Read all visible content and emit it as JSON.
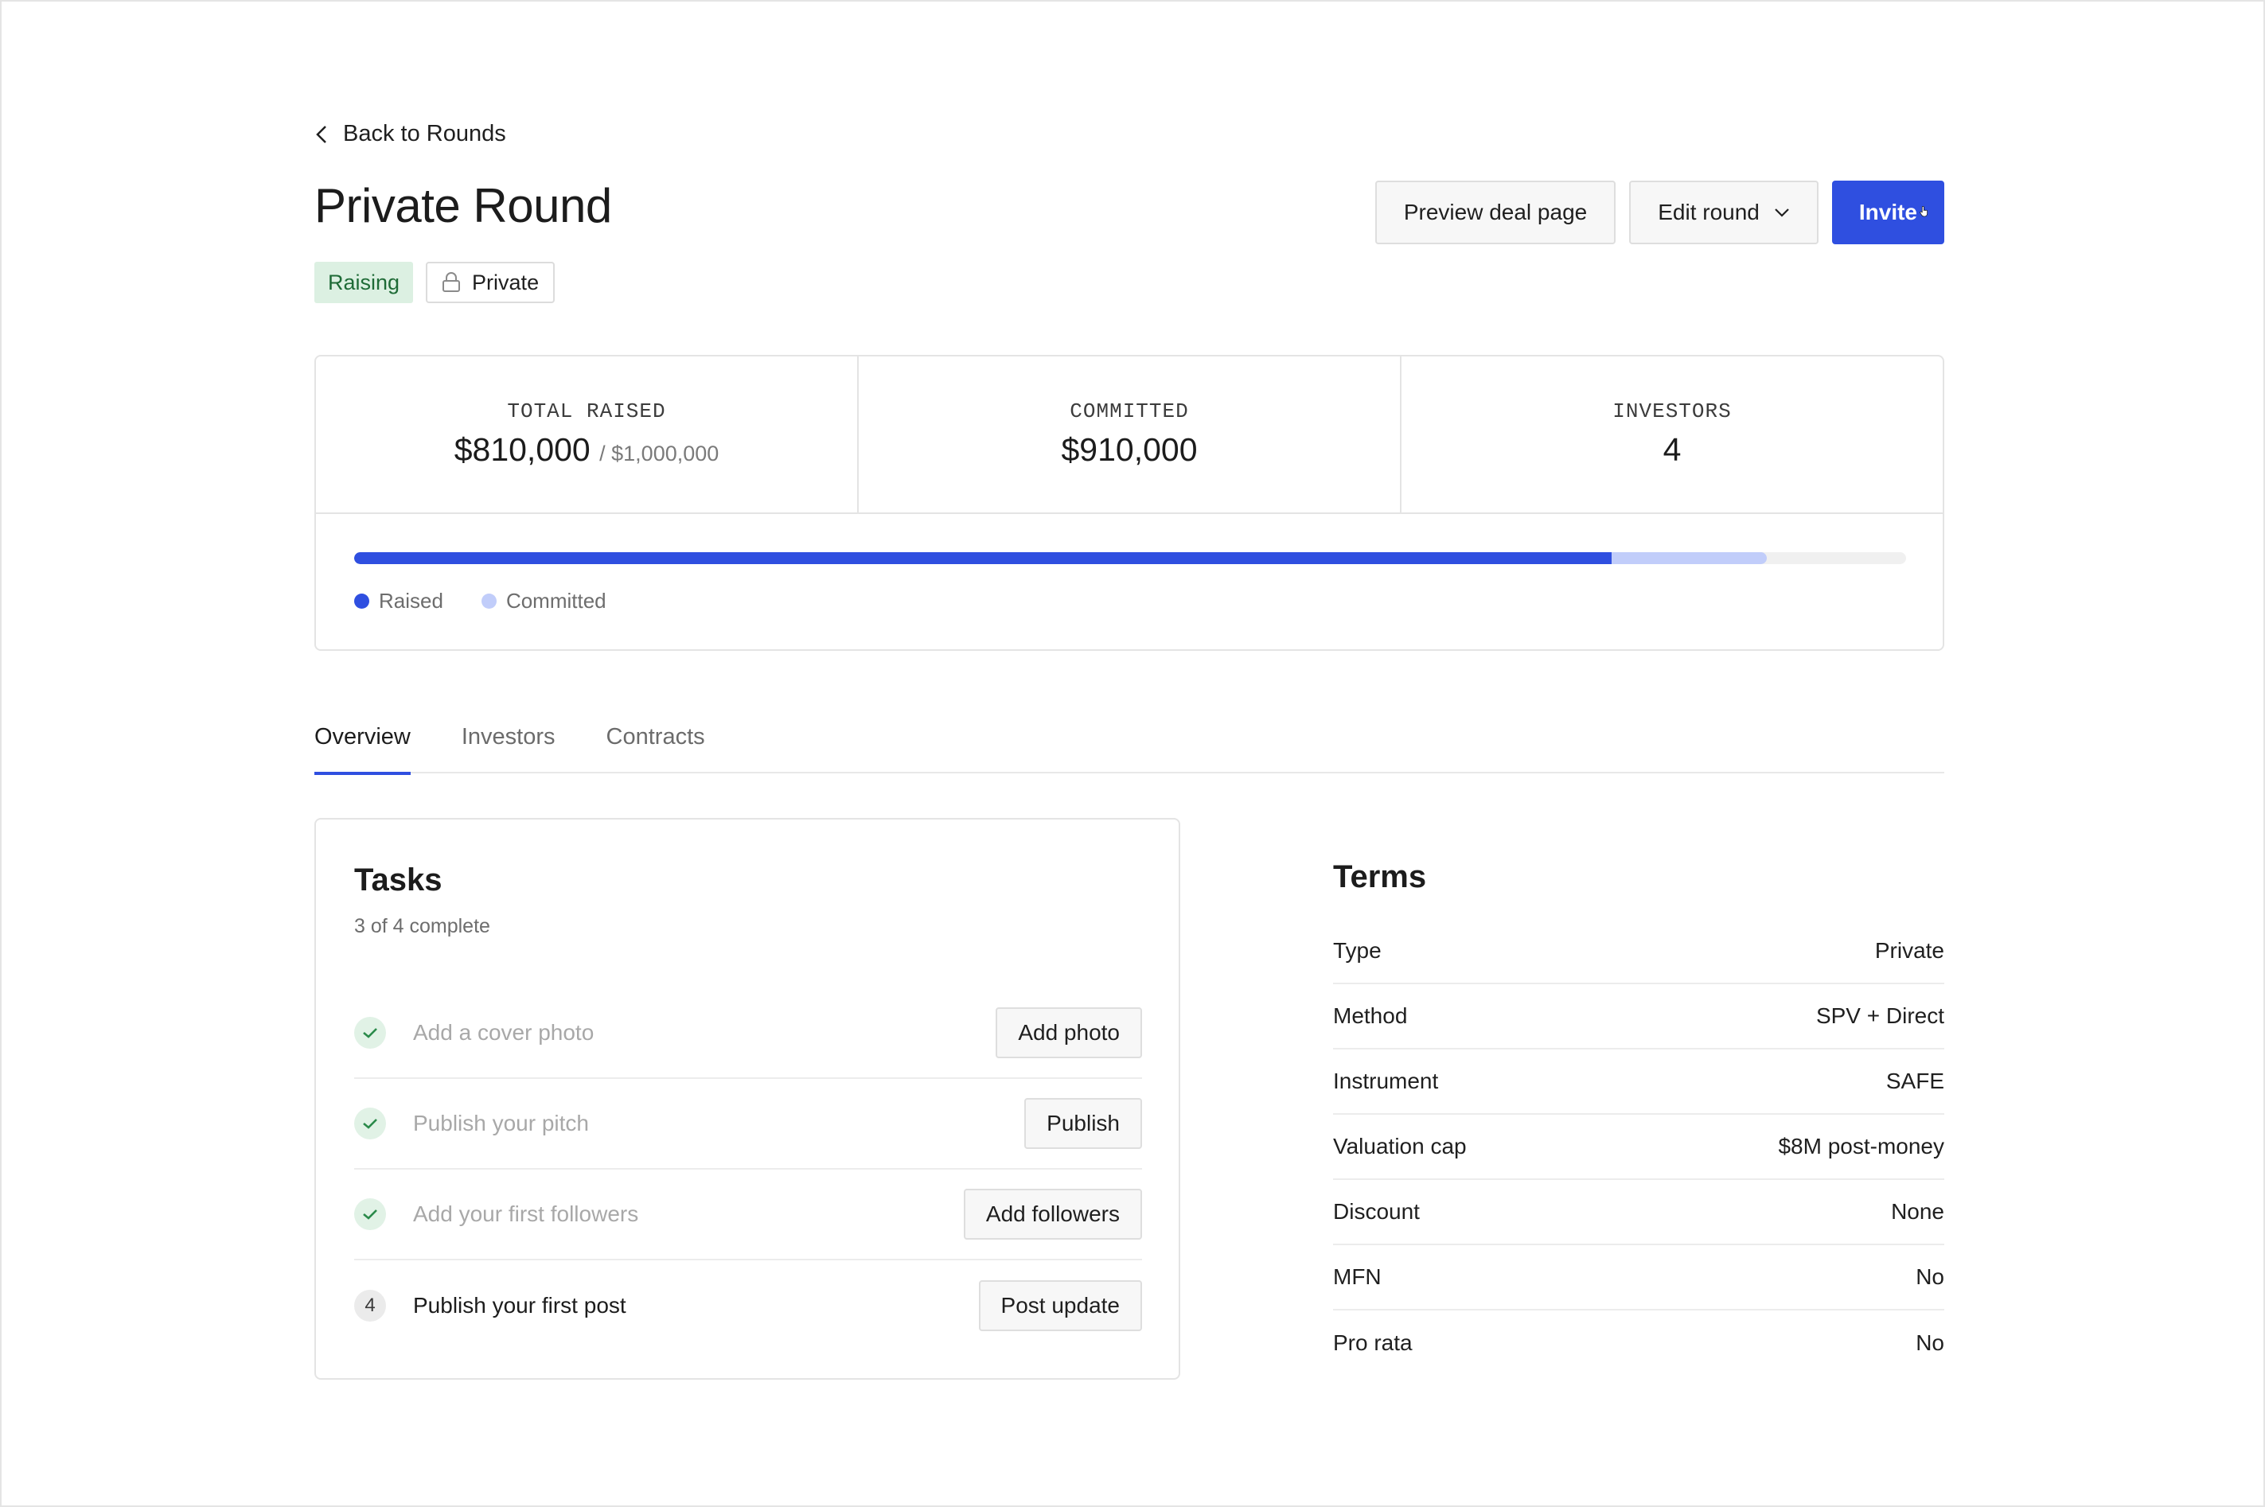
{
  "nav": {
    "back_label": "Back to Rounds"
  },
  "header": {
    "title": "Private Round",
    "status_badge": "Raising",
    "visibility_badge": "Private",
    "actions": {
      "preview_label": "Preview deal page",
      "edit_label": "Edit round",
      "invite_label": "Invite"
    }
  },
  "stats": {
    "total_raised": {
      "label": "TOTAL RAISED",
      "value": "$810,000",
      "target": "/ $1,000,000"
    },
    "committed": {
      "label": "COMMITTED",
      "value": "$910,000"
    },
    "investors": {
      "label": "INVESTORS",
      "value": "4"
    }
  },
  "progress": {
    "raised": 810000,
    "committed": 910000,
    "goal": 1000000,
    "legend": {
      "raised_label": "Raised",
      "committed_label": "Committed"
    }
  },
  "tabs": [
    {
      "label": "Overview",
      "active": true
    },
    {
      "label": "Investors",
      "active": false
    },
    {
      "label": "Contracts",
      "active": false
    }
  ],
  "tasks": {
    "title": "Tasks",
    "summary": "3 of 4 complete",
    "items": [
      {
        "text": "Add a cover photo",
        "done": true,
        "action": "Add photo"
      },
      {
        "text": "Publish your pitch",
        "done": true,
        "action": "Publish"
      },
      {
        "text": "Add your first followers",
        "done": true,
        "action": "Add followers"
      },
      {
        "text": "Publish your first post",
        "done": false,
        "step": "4",
        "action": "Post update"
      }
    ]
  },
  "terms": {
    "title": "Terms",
    "rows": [
      {
        "label": "Type",
        "value": "Private"
      },
      {
        "label": "Method",
        "value": "SPV + Direct"
      },
      {
        "label": "Instrument",
        "value": "SAFE"
      },
      {
        "label": "Valuation cap",
        "value": "$8M post-money"
      },
      {
        "label": "Discount",
        "value": "None"
      },
      {
        "label": "MFN",
        "value": "No"
      },
      {
        "label": "Pro rata",
        "value": "No"
      }
    ]
  },
  "colors": {
    "accent": "#2f4fe0",
    "committed": "#c1cdfa",
    "status_bg": "#dcf0e2",
    "status_text": "#1f6b37"
  }
}
